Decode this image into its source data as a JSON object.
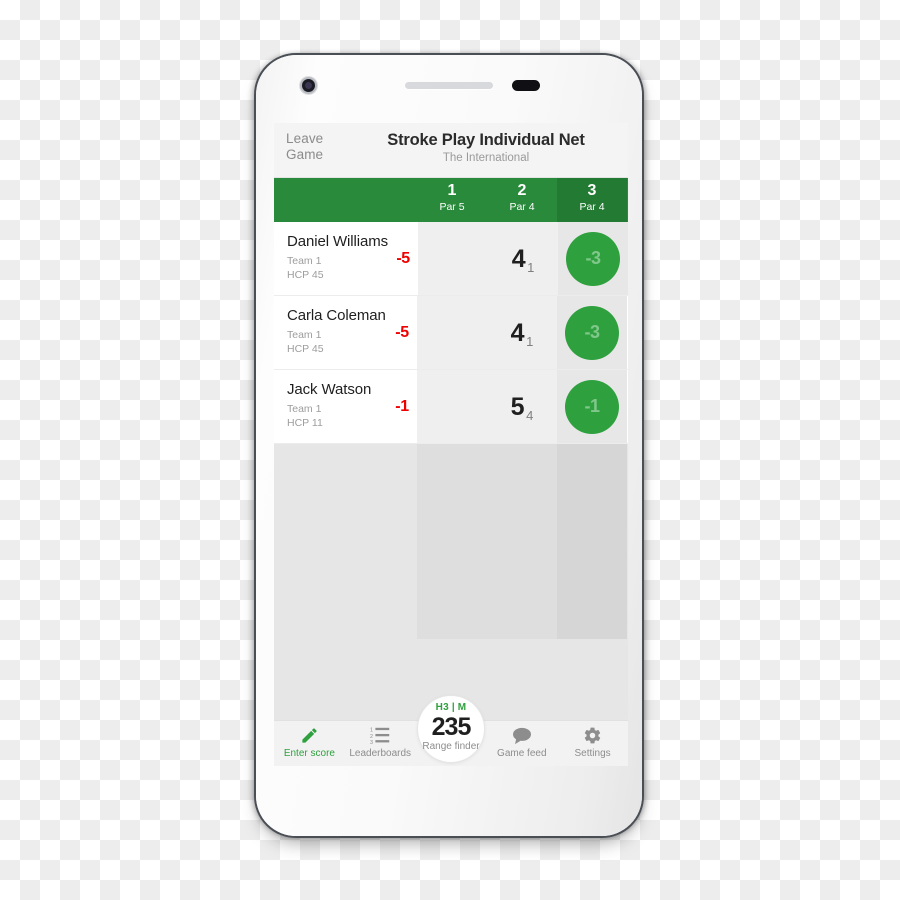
{
  "app": {
    "top_bar": {
      "leave_game_label": "Leave\nGame",
      "leave_game_line1": "Leave",
      "leave_game_line2": "Game",
      "title": "Stroke Play Individual Net",
      "subtitle": "The International"
    },
    "colors": {
      "header_green": "#2a8a3c",
      "header_green_active": "#237a33",
      "bubble_green": "#2ea03e",
      "bubble_text": "#7fc78a",
      "total_red": "#f00000",
      "accent": "#2ea03e"
    },
    "holes": [
      {
        "number": "1",
        "par": "Par 5",
        "active": false
      },
      {
        "number": "2",
        "par": "Par 4",
        "active": false
      },
      {
        "number": "3",
        "par": "Par 4",
        "active": true
      }
    ],
    "players": [
      {
        "name": "Daniel Williams",
        "team": "Team 1",
        "hcp": "HCP 45",
        "total": "-5",
        "hole2_score": "4",
        "hole2_sub": "1",
        "hole3_bubble": "-3"
      },
      {
        "name": "Carla Coleman",
        "team": "Team 1",
        "hcp": "HCP 45",
        "total": "-5",
        "hole2_score": "4",
        "hole2_sub": "1",
        "hole3_bubble": "-3"
      },
      {
        "name": "Jack Watson",
        "team": "Team 1",
        "hcp": "HCP 11",
        "total": "-1",
        "hole2_score": "5",
        "hole2_sub": "4",
        "hole3_bubble": "-1"
      }
    ],
    "bottom_nav": {
      "items": [
        {
          "label": "Enter score",
          "icon": "pencil-icon",
          "active": true
        },
        {
          "label": "Leaderboards",
          "icon": "numbered-list-icon",
          "active": false
        },
        {
          "label": "Game feed",
          "icon": "speech-bubble-icon",
          "active": false
        },
        {
          "label": "Settings",
          "icon": "gear-icon",
          "active": false
        }
      ],
      "range_finder": {
        "hole_info": "H3 | M",
        "distance": "235",
        "label": "Range finder"
      }
    }
  }
}
